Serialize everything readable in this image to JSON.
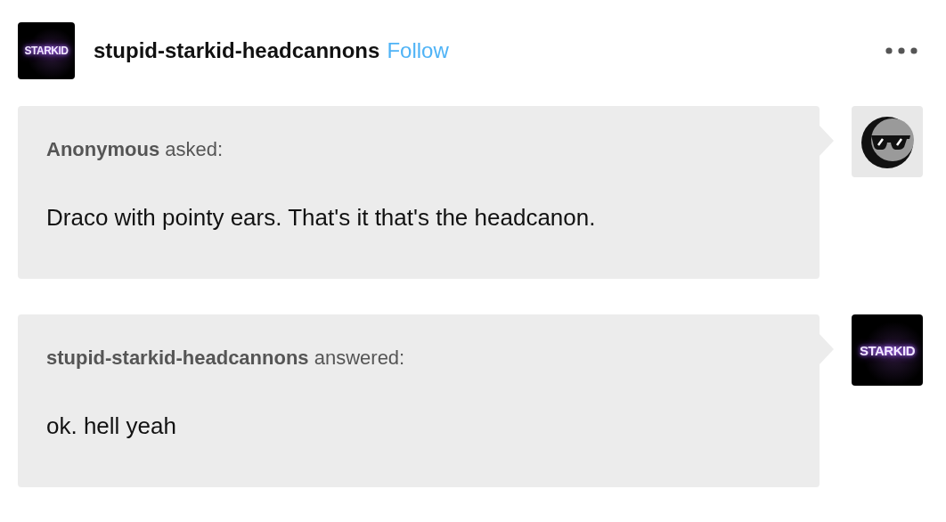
{
  "header": {
    "avatar_logo": "STARKID",
    "blog_name": "stupid-starkid-headcannons",
    "follow": "Follow"
  },
  "messages": [
    {
      "kind": "ask",
      "author": "Anonymous",
      "verb": "asked:",
      "body": "Draco with pointy ears. That's it that's the headcanon."
    },
    {
      "kind": "answer",
      "author": "stupid-starkid-headcannons",
      "verb": "answered:",
      "body": "ok. hell yeah",
      "avatar_logo": "STARKID"
    }
  ]
}
